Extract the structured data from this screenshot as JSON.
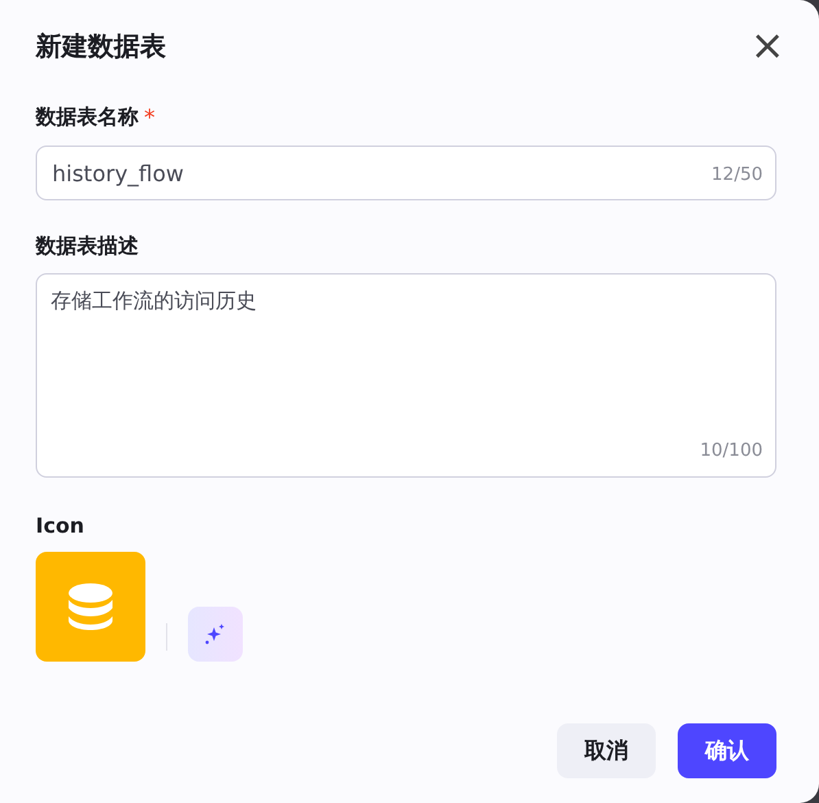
{
  "dialog": {
    "title": "新建数据表",
    "close": "×"
  },
  "fields": [
    {
      "kind": "input",
      "label": "数据表名称",
      "required_mark": "*",
      "value": "history_flow",
      "counter": "12/50"
    },
    {
      "kind": "textarea",
      "label": "数据表描述",
      "value": "存储工作流的访问历史",
      "counter": "10/100"
    }
  ],
  "icon_section": {
    "label": "Icon",
    "color": "#ffb800"
  },
  "buttons": [
    {
      "kind": "secondary",
      "label": "取消"
    },
    {
      "kind": "primary",
      "label": "确认"
    }
  ]
}
